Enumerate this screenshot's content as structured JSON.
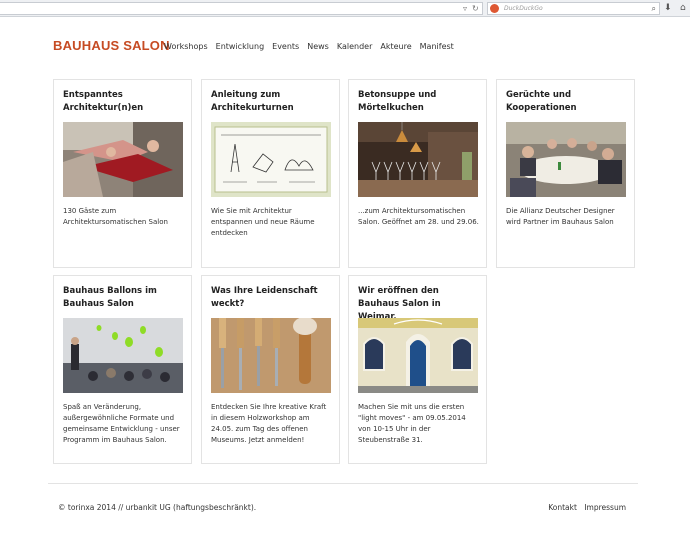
{
  "browser": {
    "search_placeholder": "DuckDuckGo"
  },
  "site": {
    "brand": "BAUHAUS SALON"
  },
  "nav": [
    "Workshops",
    "Entwicklung",
    "Events",
    "News",
    "Kalender",
    "Akteure",
    "Manifest"
  ],
  "cards": [
    {
      "title": "Entspanntes Architektur(n)en",
      "desc": "130 Gäste zum Architektursomatischen Salon",
      "image": "dancers-photo"
    },
    {
      "title": "Anleitung zum Architekurturnen",
      "desc": "Wie Sie mit Architektur entspannen und neue Räume entdecken",
      "image": "sketch-drawing"
    },
    {
      "title": "Betonsuppe und Mörtelkuchen",
      "desc": "...zum Architektursomatischen Salon. Geöffnet am 28. und 29.06.",
      "image": "bar-glasses-photo"
    },
    {
      "title": "Gerüchte und Kooperationen",
      "desc": "Die Allianz Deutscher Designer wird Partner im Bauhaus Salon",
      "image": "dinner-table-photo"
    },
    {
      "title": "Bauhaus Ballons im Bauhaus Salon",
      "desc": "Spaß an Veränderung, außergewöhnliche Formate und gemeinsame Entwicklung - unser Programm im Bauhaus Salon.",
      "image": "balloons-photo"
    },
    {
      "title": "Was Ihre Leidenschaft weckt?",
      "desc": "Entdecken Sie Ihre kreative Kraft in diesem Holzworkshop am 24.05. zum Tag des offenen Museums. Jetzt anmelden!",
      "image": "chisels-photo"
    },
    {
      "title": "Wir eröffnen den Bauhaus Salon in Weimar.",
      "desc": "Machen Sie mit uns die ersten \"light moves\" - am 09.05.2014 von 10-15 Uhr in der Steubenstraße 31.",
      "image": "facade-photo"
    }
  ],
  "footer": {
    "copyright": "© torinxa 2014 // urbankit UG (haftungsbeschränkt).",
    "links": [
      "Kontakt",
      "Impressum"
    ]
  }
}
